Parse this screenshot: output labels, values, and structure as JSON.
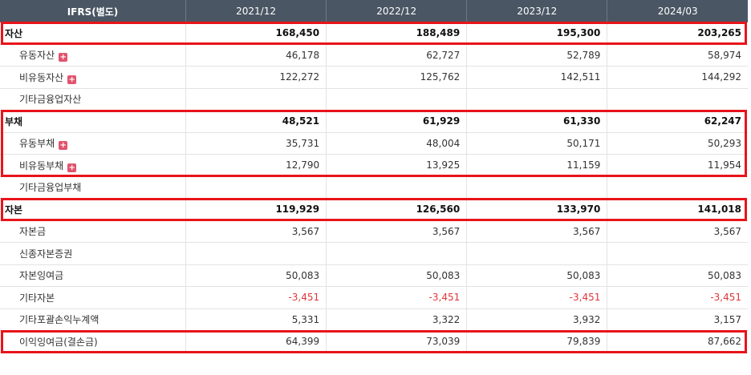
{
  "table": {
    "header": [
      "IFRS(별도)",
      "2021/12",
      "2022/12",
      "2023/12",
      "2024/03"
    ],
    "rows": [
      {
        "label": "자산",
        "values": [
          "168,450",
          "188,489",
          "195,300",
          "203,265"
        ],
        "level": "main",
        "expandable": false
      },
      {
        "label": "유동자산",
        "values": [
          "46,178",
          "62,727",
          "52,789",
          "58,974"
        ],
        "level": "sub",
        "expandable": true
      },
      {
        "label": "비유동자산",
        "values": [
          "122,272",
          "125,762",
          "142,511",
          "144,292"
        ],
        "level": "sub",
        "expandable": true
      },
      {
        "label": "기타금융업자산",
        "values": [
          "",
          "",
          "",
          ""
        ],
        "level": "sub",
        "expandable": false
      },
      {
        "label": "부채",
        "values": [
          "48,521",
          "61,929",
          "61,330",
          "62,247"
        ],
        "level": "main",
        "expandable": false
      },
      {
        "label": "유동부채",
        "values": [
          "35,731",
          "48,004",
          "50,171",
          "50,293"
        ],
        "level": "sub",
        "expandable": true
      },
      {
        "label": "비유동부채",
        "values": [
          "12,790",
          "13,925",
          "11,159",
          "11,954"
        ],
        "level": "sub",
        "expandable": true
      },
      {
        "label": "기타금융업부채",
        "values": [
          "",
          "",
          "",
          ""
        ],
        "level": "sub",
        "expandable": false
      },
      {
        "label": "자본",
        "values": [
          "119,929",
          "126,560",
          "133,970",
          "141,018"
        ],
        "level": "main",
        "expandable": false
      },
      {
        "label": "자본금",
        "values": [
          "3,567",
          "3,567",
          "3,567",
          "3,567"
        ],
        "level": "sub",
        "expandable": false
      },
      {
        "label": "신종자본증권",
        "values": [
          "",
          "",
          "",
          ""
        ],
        "level": "sub",
        "expandable": false
      },
      {
        "label": "자본잉여금",
        "values": [
          "50,083",
          "50,083",
          "50,083",
          "50,083"
        ],
        "level": "sub",
        "expandable": false
      },
      {
        "label": "기타자본",
        "values": [
          "-3,451",
          "-3,451",
          "-3,451",
          "-3,451"
        ],
        "level": "sub",
        "expandable": false
      },
      {
        "label": "기타포괄손익누계액",
        "values": [
          "5,331",
          "3,322",
          "3,932",
          "3,157"
        ],
        "level": "sub",
        "expandable": false
      },
      {
        "label": "이익잉여금(결손금)",
        "values": [
          "64,399",
          "73,039",
          "79,839",
          "87,662"
        ],
        "level": "sub",
        "expandable": false
      }
    ],
    "expand_icon": "plus-icon",
    "colors": {
      "header_bg": "#4a5663",
      "highlight": "#e8141a",
      "negative": "#e0353a",
      "expand_icon": "#e2536d"
    }
  }
}
